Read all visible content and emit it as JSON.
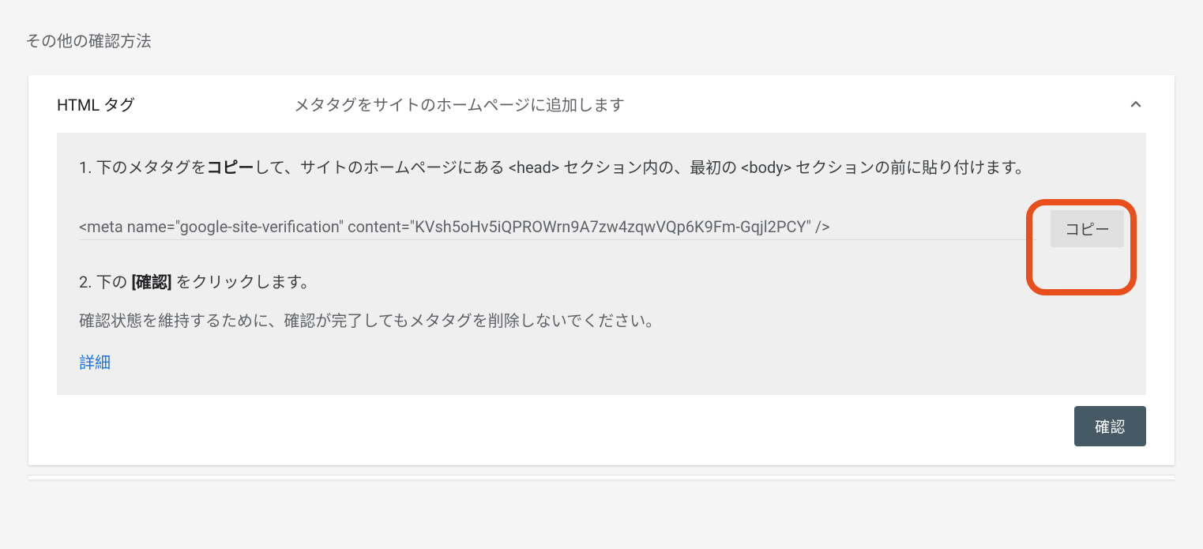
{
  "page": {
    "title": "その他の確認方法"
  },
  "card": {
    "header": {
      "title": "HTML タグ",
      "description": "メタタグをサイトのホームページに追加します"
    },
    "body": {
      "step1": {
        "n": "1. ",
        "pre": "下のメタタグを",
        "bold": "コピー",
        "post": "して、サイトのホームページにある <head> セクション内の、最初の <body> セクションの前に貼り付けます。"
      },
      "code": "<meta name=\"google-site-verification\" content=\"KVsh5oHv5iQPROWrn9A7zw4zqwVQp6K9Fm-Gqjl2PCY\" />",
      "copy_label": "コピー",
      "step2": {
        "n": "2. ",
        "pre": "下の ",
        "bold": "[確認]",
        "post": " をクリックします。"
      },
      "note": "確認状態を維持するために、確認が完了してもメタタグを削除しないでください。",
      "details_link": "詳細"
    },
    "footer": {
      "confirm_label": "確認"
    }
  }
}
